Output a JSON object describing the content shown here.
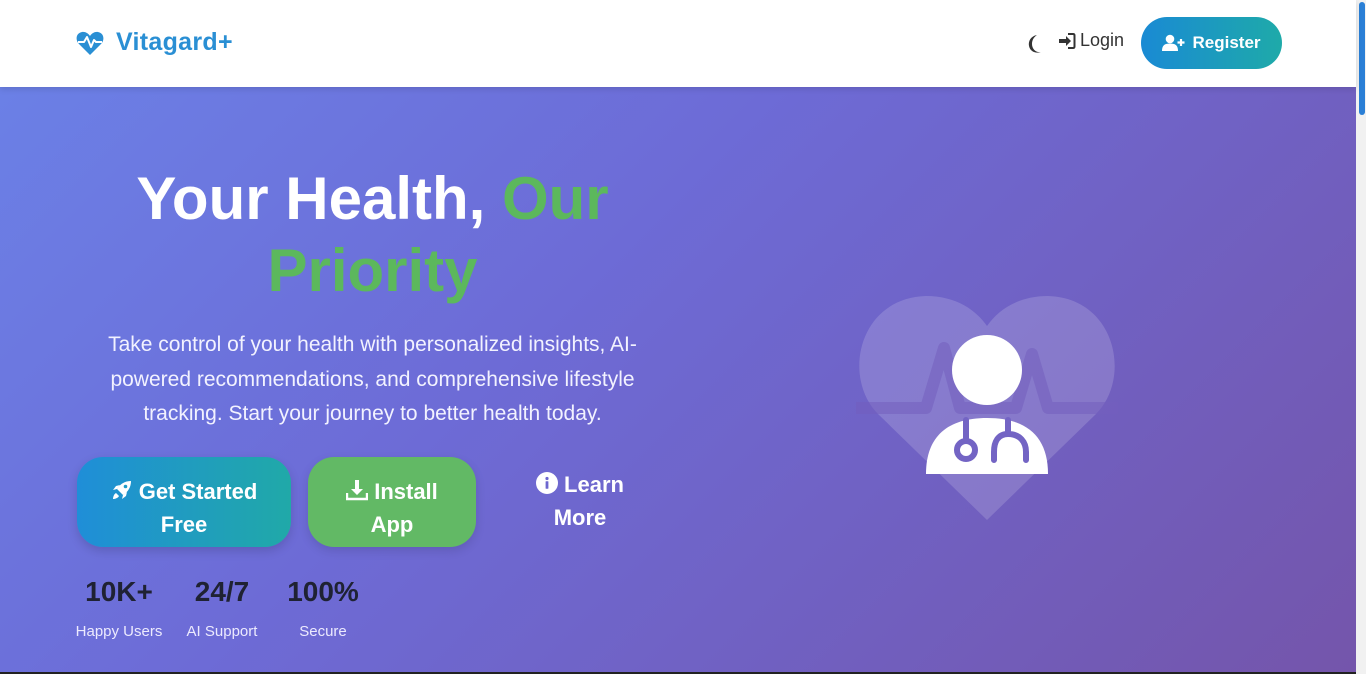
{
  "nav": {
    "brand_name": "Vitagard+",
    "brand_icon": "heart-pulse-icon",
    "theme_icon": "moon-icon",
    "login_label": "Login",
    "register_label": "Register"
  },
  "hero": {
    "headline_main": "Your Health,",
    "headline_accent": "Our Priority",
    "description": "Take control of your health with personalized insights, AI-powered recommendations, and comprehensive lifestyle tracking. Start your journey to better health today.",
    "cta_primary": {
      "line1": "Get Started",
      "line2": "Free",
      "icon": "rocket-icon"
    },
    "cta_secondary": {
      "line1": "Install",
      "line2": "App",
      "icon": "download-icon"
    },
    "cta_link": {
      "line1": "Learn",
      "line2": "More",
      "icon": "info-circle-icon"
    },
    "stats": [
      {
        "value": "10K+",
        "label": "Happy Users"
      },
      {
        "value": "24/7",
        "label": "AI Support"
      },
      {
        "value": "100%",
        "label": "Secure"
      }
    ],
    "illustration_icon": "doctor-heart-icon"
  },
  "colors": {
    "brand": "#2a8fd4",
    "accent_green": "#5cb85c",
    "hero_gradient_start": "#6b80e6",
    "hero_gradient_end": "#7455ab"
  }
}
